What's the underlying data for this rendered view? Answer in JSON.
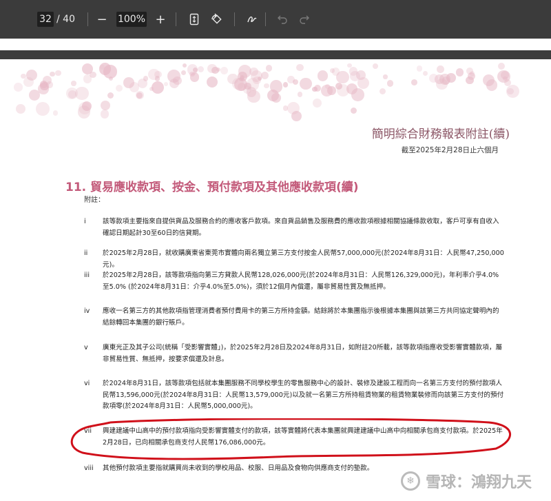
{
  "toolbar": {
    "current_page": "32",
    "total_pages": "/ 40",
    "zoom_out": "−",
    "zoom": "100%",
    "zoom_in": "+",
    "fit_icon": "fit-page-icon",
    "rotate_icon": "rotate-icon",
    "draw_icon": "draw-icon",
    "undo_icon": "undo-icon",
    "redo_icon": "redo-icon"
  },
  "document": {
    "title": "簡明綜合財務報表附註(續)",
    "subtitle": "截至2025年2月28日止六個月",
    "section_title": "11. 貿易應收款項、按金、預付款項及其他應收款項(續)",
    "notes_label": "附註：",
    "notes": [
      {
        "num": "i",
        "text": "該等款項主要指來自提供貨品及服務合約的應收客戶款項。來自貨品銷售及服務費的應收款項根據相關協議條款收取，客戶可享有自收入確認日期起計30至60日的信貸期。"
      },
      {
        "num": "ii",
        "text": "於2025年2月28日，就收購廣東省東莞市實體向兩名獨立第三方支付按金人民幣57,000,000元(於2024年8月31日：人民幣47,250,000元)。"
      },
      {
        "num": "iii",
        "text": "於2025年2月28日，該等款項指向第三方貸款人民幣128,026,000元(於2024年8月31日：人民幣126,329,000元)，年利率介乎4.0%至5.0% (於2024年8月31日：介乎4.0%至5.0%)，須於12個月內償還，屬非貿易性質及無抵押。"
      },
      {
        "num": "iv",
        "text": "應收一名第三方的其他款項指管理消費者預付費用卡的第三方所持金額。結餘將於本集團指示後根據本集團與該第三方共同協定聲明內的結餘轉回本集團的銀行賬戶。"
      },
      {
        "num": "v",
        "text": "廣東光正及其子公司(統稱「受影響實體」)，於2025年2月28日及2024年8月31日，如附註20所載，該等款項指應收受影響實體款項，屬非貿易性質、無抵押，按要求償還及計息。"
      },
      {
        "num": "vi",
        "text": "於2024年8月31日，該等款項包括就本集團服務不同學校學生的零售服務中心的設計、裝修及建設工程而向一名第三方支付的預付款項人民幣13,596,000元(於2024年8月31日：人民幣13,579,000元)以及就一名第三方所持租賃物業的租賃物業裝修而向該第三方支付的預付款項零(於2024年8月31日：人民幣5,000,000元)。"
      },
      {
        "num": "vii",
        "text": "興建建議中山高中的預付款項指向受影響實體支付的款項，該等實體將代表本集團就興建建議中山高中向相關承包商支付款項。於2025年2月28日，已向相關承包商支付人民幣176,086,000元。"
      },
      {
        "num": "viii",
        "text": "其他預付款項主要指就購買尚未收到的學校用品、校服、日用品及食物向供應商支付的墊款。"
      }
    ]
  },
  "watermark": {
    "text": "雪球：鴻翔九天"
  },
  "colors": {
    "title": "#8b5565",
    "section_title": "#c35a7a",
    "annotation": "#d0101a"
  }
}
